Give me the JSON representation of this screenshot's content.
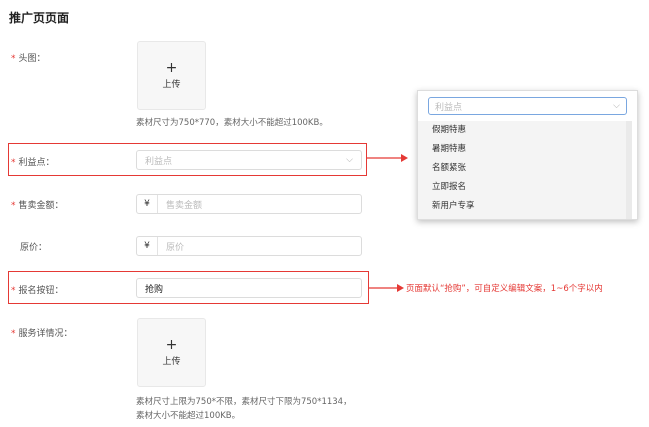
{
  "page": {
    "title": "推广页页面"
  },
  "form": {
    "avatar": {
      "label": "头图：",
      "upload_plus": "+",
      "upload_text": "上传",
      "hint": "素材尺寸为750*770，素材大小不能超过100KB。"
    },
    "benefit": {
      "label": "利益点：",
      "placeholder": "利益点"
    },
    "sale_price": {
      "label": "售卖金额：",
      "prefix": "¥",
      "placeholder": "售卖金额"
    },
    "original_price": {
      "label": "原价：",
      "prefix": "¥",
      "placeholder": "原价"
    },
    "signup_button": {
      "label": "报名按钮：",
      "value": "抢购"
    },
    "service_detail": {
      "label": "服务详情况：",
      "upload_plus": "+",
      "upload_text": "上传",
      "hint_line1": "素材尺寸上限为750*不限，素材尺寸下限为750*1134，",
      "hint_line2": "素材大小不能超过100KB。"
    },
    "required_mark": "*"
  },
  "dropdown": {
    "placeholder": "利益点",
    "options": [
      "假期特惠",
      "暑期特惠",
      "名额紧张",
      "立即报名",
      "新用户专享"
    ]
  },
  "annotation": {
    "text": "页面默认“抢购”，可自定义编辑文案，1~6个字以内"
  },
  "colors": {
    "highlight": "#e53935",
    "focus": "#7aa7e0"
  }
}
